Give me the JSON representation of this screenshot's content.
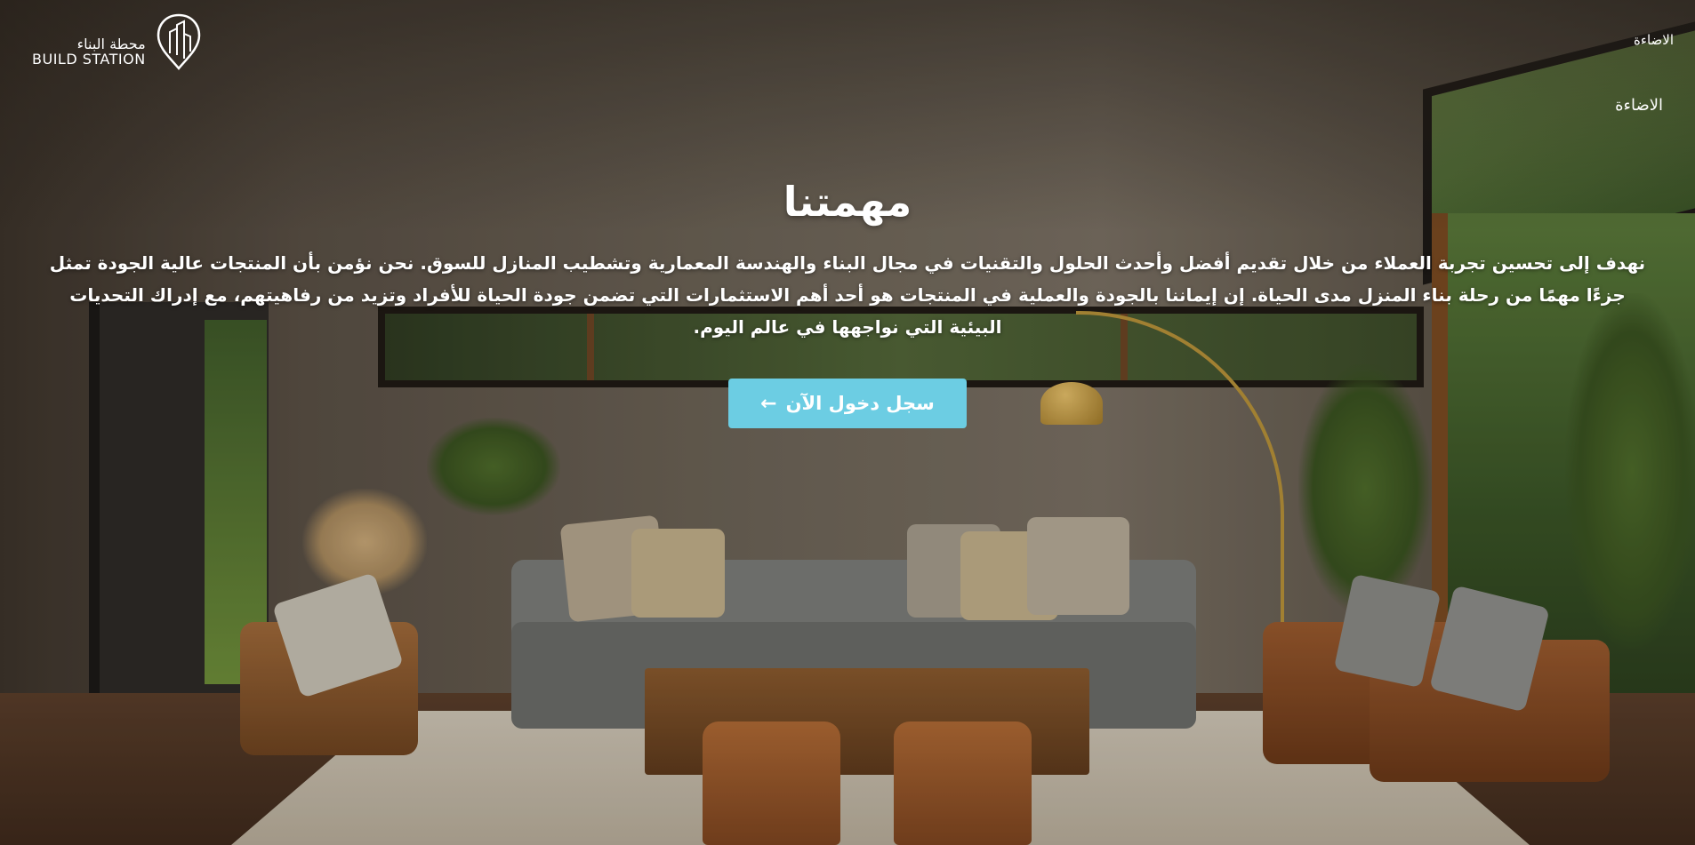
{
  "brand": {
    "name_ar": "محطة البناء",
    "name_en": "BUILD STATION",
    "logo_icon": "building-pin-icon"
  },
  "nav": {
    "top_link": "الاضاءة",
    "second_link": "الاضاءة"
  },
  "hero": {
    "title": "مهمتنا",
    "description": "نهدف إلى تحسين تجربة العملاء من خلال تقديم أفضل وأحدث الحلول والتقنيات في مجال البناء والهندسة المعمارية وتشطيب المنازل للسوق. نحن نؤمن بأن المنتجات عالية الجودة تمثل جزءًا مهمًا من رحلة بناء المنزل مدى الحياة. إن إيماننا بالجودة والعملية في المنتجات هو أحد أهم الاستثمارات التي تضمن جودة الحياة للأفراد وتزيد من رفاهيتهم، مع إدراك التحديات البيئية التي نواجهها في عالم اليوم.",
    "cta_label": "سجل دخول الآن",
    "cta_icon": "arrow-left-icon",
    "cta_arrow": "←",
    "cta_color": "#6ccde3"
  }
}
